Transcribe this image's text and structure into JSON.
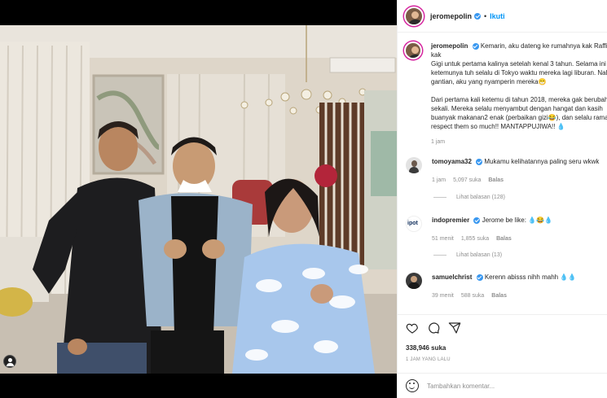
{
  "post": {
    "username": "jeromepolin",
    "follow_label": "Ikuti",
    "separator": "•",
    "caption_text": "Kemarin, aku dateng ke rumahnya kak Raffi dan kak\nGigi untuk pertama kalinya setelah kenal 3 tahun. Selama ini\nketemunya tuh selalu di Tokyo waktu mereka lagi liburan. Nah\ngantian, aku yang nyamperin mereka😁\n\nDari pertama kali ketemu di tahun 2018, mereka gak berubah\nsekali. Mereka selalu menyambut dengan hangat dan kasih\nbuanyak makanan2 enak (perbaikan gizi😂), dan selalu ramah. I\nrespect them so much!! MANTAPPUJIWA!! 💧",
    "caption_time": "1 jam",
    "likes": "338,946 suka",
    "time_ago": "1 JAM YANG LALU",
    "comment_placeholder": "Tambahkan komentar..."
  },
  "comments": [
    {
      "username": "tomoyama32",
      "text": "Mukamu kelihatannya paling seru wkwk",
      "time": "1 jam",
      "likes": "5,097 suka",
      "reply_label": "Balas",
      "replies": "Lihat balasan (128)"
    },
    {
      "username": "indopremier",
      "text": "Jerome be like: 💧😂💧",
      "time": "51 menit",
      "likes": "1,855 suka",
      "reply_label": "Balas",
      "replies": "Lihat balasan (13)"
    },
    {
      "username": "samuelchrist",
      "text": "Kerenn abisss nihh mahh 💧💧",
      "time": "39 menit",
      "likes": "588 suka",
      "reply_label": "Balas"
    }
  ],
  "icons": {
    "like": "heart-icon",
    "comment": "comment-icon",
    "share": "share-icon",
    "emoji": "emoji-icon",
    "tag": "user-tag-icon",
    "verified": "verified-badge-icon"
  },
  "colors": {
    "follow": "#0095f6",
    "verified": "#3897f0",
    "muted": "#8e8e8e",
    "text": "#262626"
  }
}
